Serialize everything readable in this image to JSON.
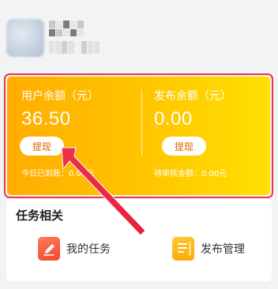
{
  "balance": {
    "user": {
      "label": "用户余额（元）",
      "value": "36.50",
      "button": "提现",
      "note": "今日已到账：0.00元"
    },
    "publish": {
      "label": "发布余额（元）",
      "value": "0.00",
      "button": "提现",
      "note": "待审核金额：0.00元"
    }
  },
  "tasks": {
    "title": "任务相关",
    "items": [
      {
        "label": "我的任务",
        "icon": "edit-icon"
      },
      {
        "label": "发布管理",
        "icon": "document-icon"
      }
    ]
  },
  "colors": {
    "card_start": "#ffad00",
    "card_end": "#ffe000",
    "highlight_border": "#e8374a",
    "annotation_arrow": "#f0304a"
  }
}
